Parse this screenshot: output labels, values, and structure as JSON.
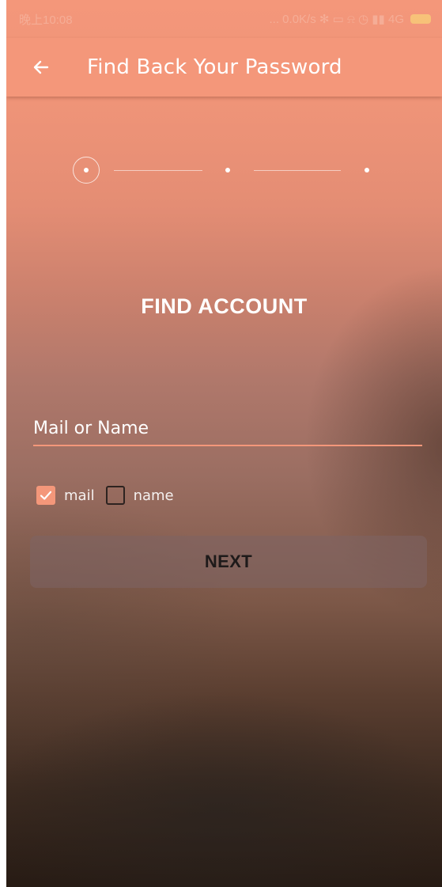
{
  "status_bar": {
    "time": "晚上10:08",
    "right_text": "...  0.0K/s ✻ ▭  ⍾ ◷ ▮▮ 4G"
  },
  "app_bar": {
    "back_icon": "arrow-left-icon",
    "title": "Find Back Your Password"
  },
  "stepper": {
    "current_step": 1,
    "total_steps": 3
  },
  "main": {
    "heading": "FIND ACCOUNT",
    "input": {
      "placeholder": "Mail or Name",
      "value": ""
    },
    "options": [
      {
        "label": "mail",
        "checked": true
      },
      {
        "label": "name",
        "checked": false
      }
    ],
    "next_label": "NEXT"
  },
  "colors": {
    "accent": "#f4977a",
    "text_on_accent": "#ffffff"
  }
}
